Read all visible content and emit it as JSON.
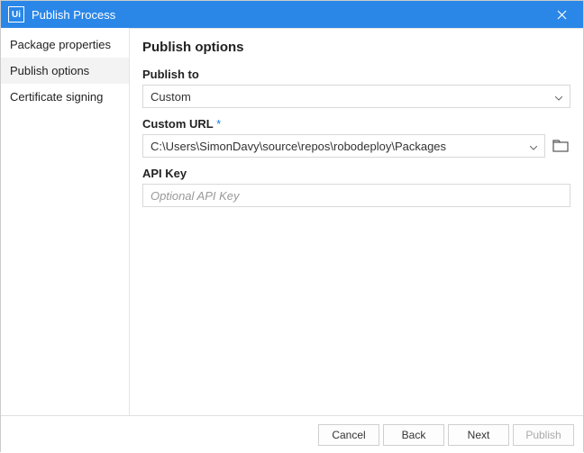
{
  "window": {
    "title": "Publish Process",
    "logo_text": "Ui"
  },
  "sidebar": {
    "items": [
      {
        "label": "Package properties"
      },
      {
        "label": "Publish options"
      },
      {
        "label": "Certificate signing"
      }
    ],
    "selected_index": 1
  },
  "main": {
    "heading": "Publish options",
    "publish_to": {
      "label": "Publish to",
      "value": "Custom"
    },
    "custom_url": {
      "label": "Custom URL",
      "required_mark": "*",
      "value": "C:\\Users\\SimonDavy\\source\\repos\\robodeploy\\Packages"
    },
    "api_key": {
      "label": "API Key",
      "placeholder": "Optional API Key",
      "value": ""
    }
  },
  "footer": {
    "cancel": "Cancel",
    "back": "Back",
    "next": "Next",
    "publish": "Publish"
  }
}
